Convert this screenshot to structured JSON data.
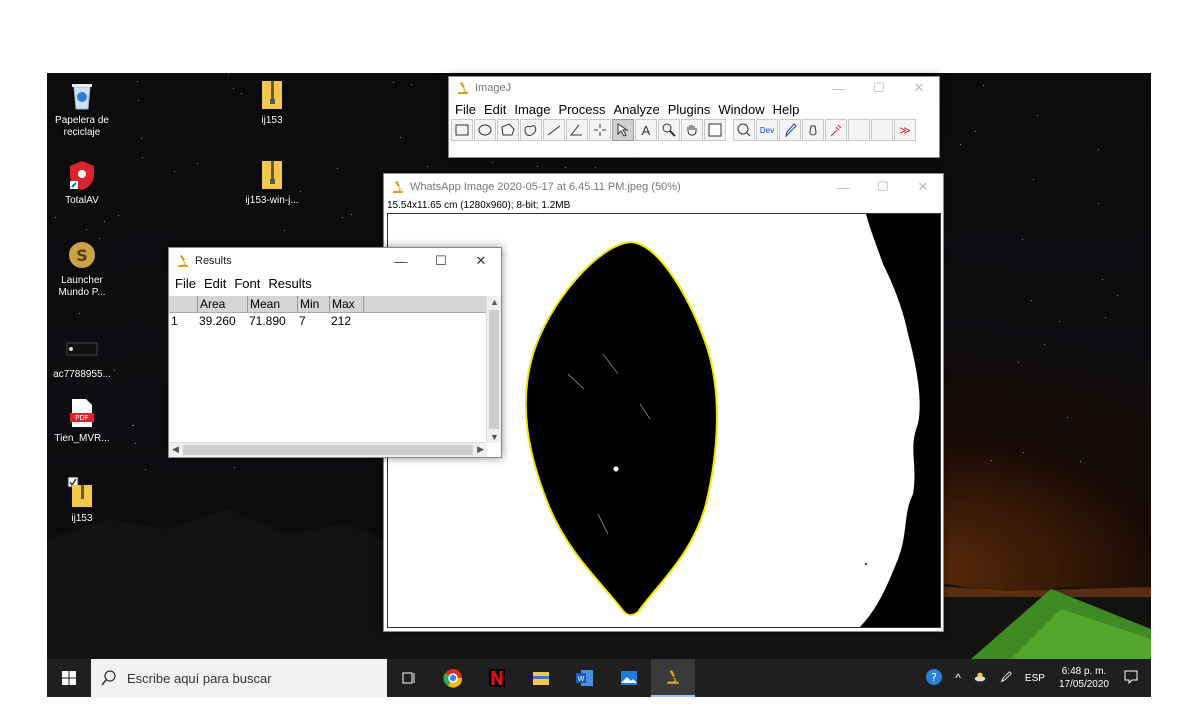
{
  "desktop": {
    "icons": [
      {
        "label": "Papelera de\nreciclaje",
        "icon": "recycle-bin-icon"
      },
      {
        "label": "ij153",
        "icon": "zip-folder-icon"
      },
      {
        "label": "TotalAV",
        "icon": "totalav-icon"
      },
      {
        "label": "ij153-win-j...",
        "icon": "zip-folder-icon"
      },
      {
        "label": "Launcher\nMundo P...",
        "icon": "launcher-icon"
      },
      {
        "label": "ac7788955...",
        "icon": "image-thumbnail-icon"
      },
      {
        "label": "Tien_MVR...",
        "icon": "pdf-icon"
      },
      {
        "label": "ij153",
        "icon": "folder-icon"
      }
    ]
  },
  "imagej": {
    "title": "ImageJ",
    "menu": [
      "File",
      "Edit",
      "Image",
      "Process",
      "Analyze",
      "Plugins",
      "Window",
      "Help"
    ],
    "tools": [
      "rectangle",
      "oval",
      "polygon",
      "freehand",
      "line",
      "angle",
      "point",
      "wand",
      "text",
      "magnifier",
      "scroll",
      "color-picker",
      "zoom",
      "Dev",
      "pencil",
      "paintbrush",
      "dropper",
      "blank",
      "blank",
      "more"
    ],
    "dev_label": "Dev",
    "text_tool_label": "A",
    "more_label": "≫"
  },
  "image_window": {
    "title": "WhatsApp Image 2020-05-17 at 6.45.11 PM.jpeg (50%)",
    "info": "15.54x11.65 cm (1280x960); 8-bit; 1.2MB"
  },
  "results": {
    "title": "Results",
    "menu": [
      "File",
      "Edit",
      "Font",
      "Results"
    ],
    "columns": [
      "",
      "Area",
      "Mean",
      "Min",
      "Max"
    ],
    "rows": [
      [
        "1",
        "39.260",
        "71.890",
        "7",
        "212"
      ]
    ]
  },
  "taskbar": {
    "search_placeholder": "Escribe aquí para buscar",
    "language": "ESP",
    "time": "6:48 p. m.",
    "date": "17/05/2020"
  },
  "colors": {
    "taskbar": "#1f1f1f",
    "leaf_outline": "#f3e600",
    "selected_tool": "#cfcfcf"
  }
}
